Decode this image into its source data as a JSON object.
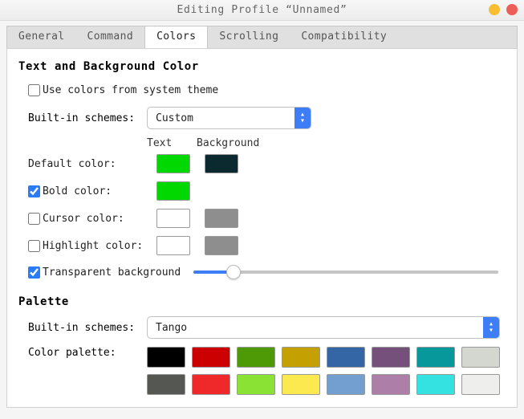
{
  "window": {
    "title": "Editing Profile  “Unnamed”"
  },
  "tabs": {
    "general": "General",
    "command": "Command",
    "colors": "Colors",
    "scrolling": "Scrolling",
    "compatibility": "Compatibility",
    "active": "colors"
  },
  "section1": {
    "heading": "Text and Background Color",
    "use_system": {
      "label": "Use colors from system theme",
      "checked": false
    },
    "scheme_label": "Built-in schemes:",
    "scheme_value": "Custom",
    "col_text": "Text",
    "col_bg": "Background",
    "default_label": "Default color:",
    "default_text_color": "#00d800",
    "default_bg_color": "#0a2a2f",
    "bold": {
      "label": "Bold color:",
      "checked": true,
      "color": "#00d800"
    },
    "cursor": {
      "label": "Cursor color:",
      "checked": false,
      "text_color": "#ffffff",
      "bg_color": "#8e8e8e"
    },
    "highlight": {
      "label": "Highlight color:",
      "checked": false,
      "text_color": "#ffffff",
      "bg_color": "#8e8e8e"
    },
    "transparent": {
      "label": "Transparent background",
      "checked": true,
      "value_pct": 13
    }
  },
  "palette": {
    "heading": "Palette",
    "scheme_label": "Built-in schemes:",
    "scheme_value": "Tango",
    "palette_label": "Color palette:",
    "colors": [
      "#000000",
      "#cc0000",
      "#4e9a06",
      "#c4a000",
      "#3465a4",
      "#75507b",
      "#06989a",
      "#d3d7cf",
      "#555753",
      "#ef2929",
      "#8ae234",
      "#fce94f",
      "#729fcf",
      "#ad7fa8",
      "#34e2e2",
      "#eeeeec"
    ]
  }
}
